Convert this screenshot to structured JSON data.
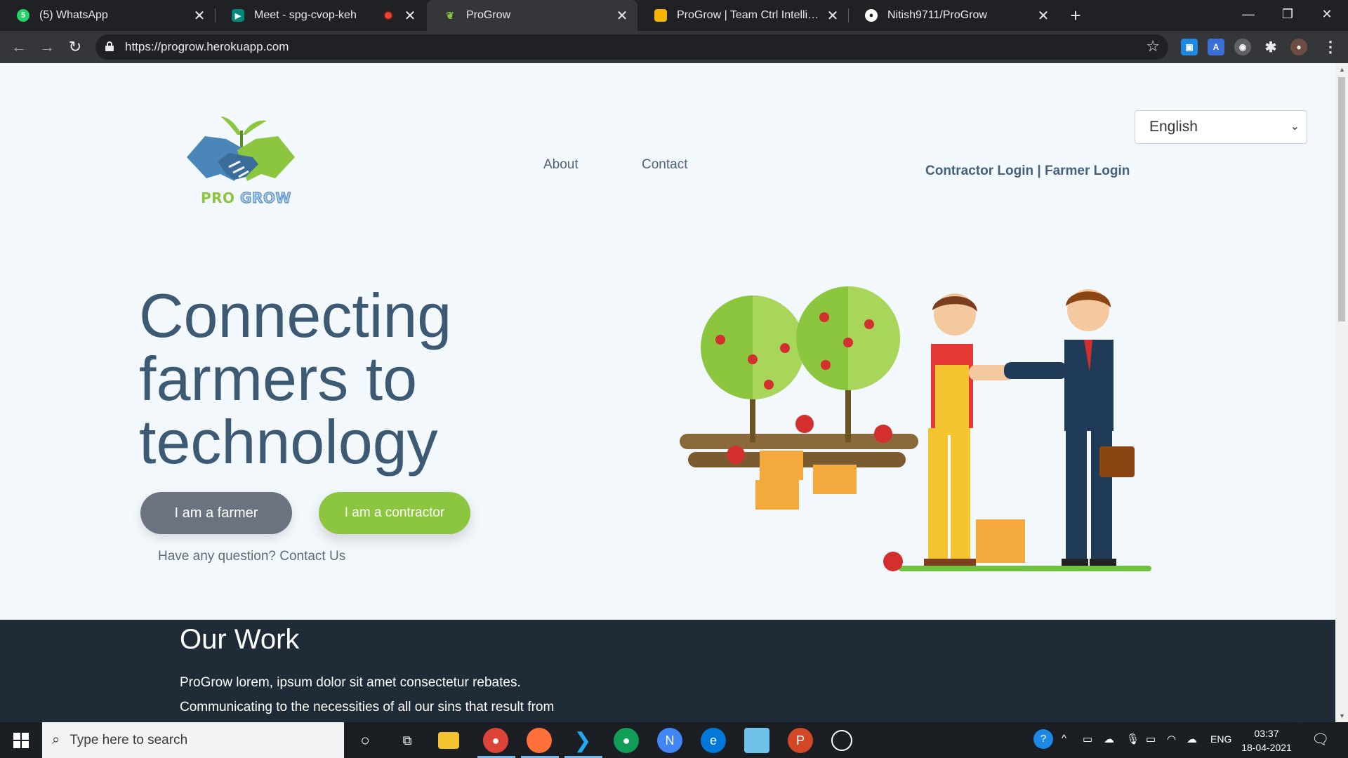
{
  "browser": {
    "tabs": [
      {
        "title": "(5) WhatsApp",
        "icon": "whatsapp-icon",
        "color": "#25d366"
      },
      {
        "title": "Meet - spg-cvop-keh",
        "icon": "google-meet-icon",
        "color": "#00897b"
      },
      {
        "title": "ProGrow",
        "icon": "progrow-icon",
        "color": "#8cc63f"
      },
      {
        "title": "ProGrow | Team Ctrl Intelligence",
        "icon": "google-slides-icon",
        "color": "#f4b400"
      },
      {
        "title": "Nitish9711/ProGrow",
        "icon": "github-icon",
        "color": "#ffffff"
      }
    ],
    "active_tab": 2,
    "url": "https://progrow.herokuapp.com"
  },
  "page": {
    "logo": {
      "pro": "PRO",
      "grow": "GROW"
    },
    "nav": {
      "about": "About",
      "contact": "Contact"
    },
    "logins": "Contractor Login | Farmer Login",
    "language": {
      "selected": "English"
    },
    "hero": {
      "title_lines": [
        "Connecting",
        "farmers to",
        "technology"
      ],
      "farmer_button": "I am a farmer",
      "contractor_button": "I am a contractor",
      "question": "Have any question? Contact Us"
    },
    "our_work": {
      "heading": "Our Work",
      "lines": [
        "ProGrow lorem, ipsum dolor sit amet consectetur rebates.",
        "Communicating to the necessities of all our sins that result from"
      ]
    }
  },
  "taskbar": {
    "search_placeholder": "Type here to search",
    "language": "ENG",
    "time": "03:37",
    "date": "18-04-2021"
  },
  "colors": {
    "accent_green": "#8cc63f",
    "heading_blue": "#3c5a73",
    "dark_section": "#1f2c37",
    "chat_blue": "#1877f2"
  }
}
